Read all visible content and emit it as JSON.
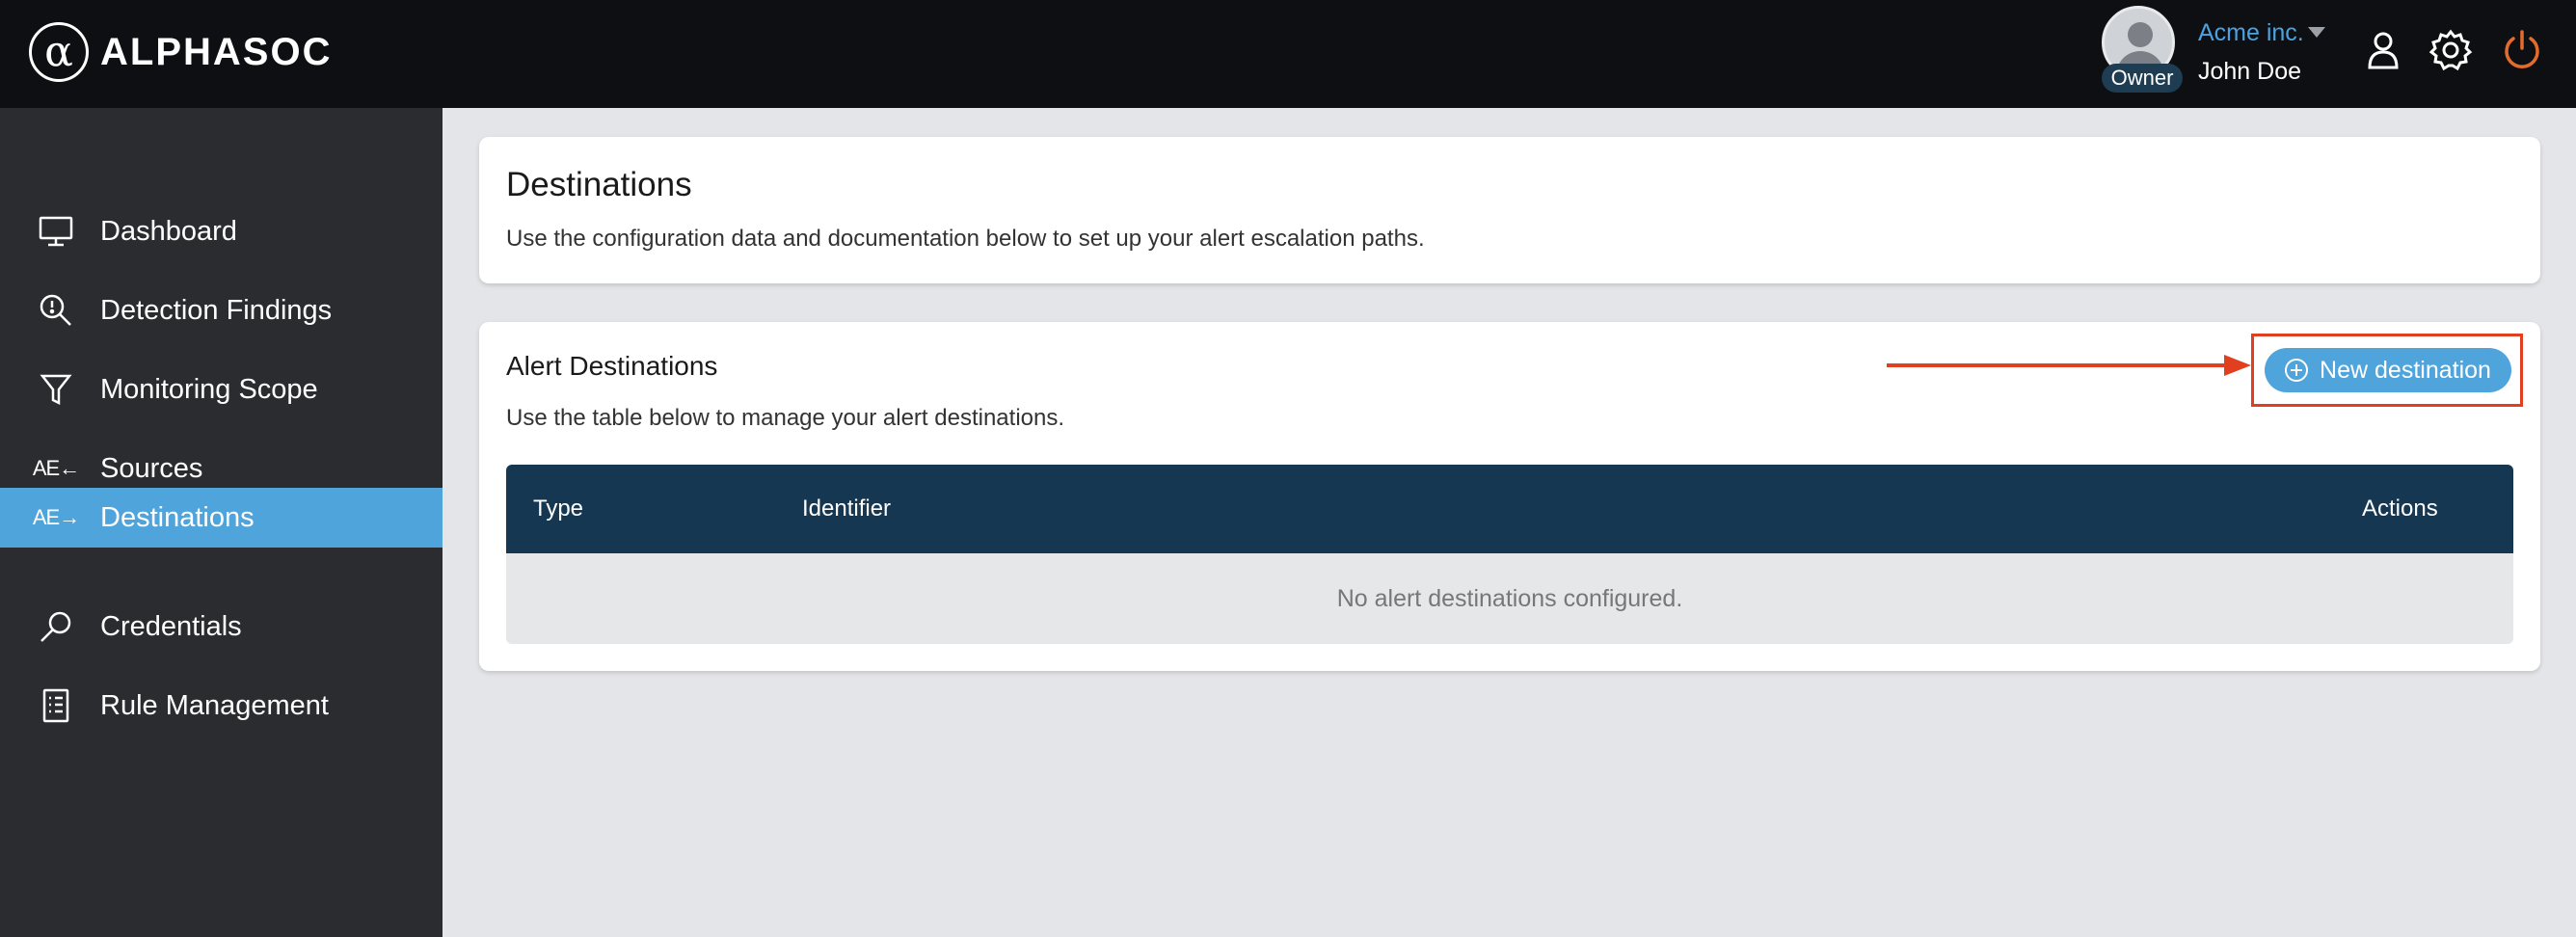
{
  "brand": {
    "logo_glyph": "α",
    "name": "ALPHASOC"
  },
  "user": {
    "org": "Acme inc.",
    "name": "John Doe",
    "role": "Owner"
  },
  "top_icons": [
    "user-icon",
    "gear-icon",
    "power-icon"
  ],
  "colors": {
    "topbar": "#0e0f12",
    "sidebar": "#2b2c30",
    "accent": "#4fa4dc",
    "table_header": "#163752",
    "highlight": "#e0401f",
    "power_icon": "#e36b2c"
  },
  "sidebar": {
    "items": [
      {
        "label": "Dashboard",
        "icon": "monitor-icon",
        "active": false
      },
      {
        "label": "Detection Findings",
        "icon": "magnifier-alert-icon",
        "active": false
      },
      {
        "label": "Monitoring Scope",
        "icon": "filter-icon",
        "active": false
      },
      {
        "label": "Sources",
        "icon": "sources-icon",
        "icon_text": "AE←",
        "active": false
      },
      {
        "label": "Destinations",
        "icon": "destinations-icon",
        "icon_text": "AE→",
        "active": true
      },
      {
        "label": "Credentials",
        "icon": "key-search-icon",
        "active": false
      },
      {
        "label": "Rule Management",
        "icon": "rules-list-icon",
        "active": false
      }
    ]
  },
  "page": {
    "title": "Destinations",
    "subtitle": "Use the configuration data and documentation below to set up your alert escalation paths."
  },
  "alert_destinations": {
    "title": "Alert Destinations",
    "subtitle": "Use the table below to manage your alert destinations.",
    "new_button_label": "New destination",
    "table": {
      "columns": [
        "Type",
        "Identifier",
        "Actions"
      ],
      "rows": [],
      "empty_message": "No alert destinations configured."
    }
  }
}
